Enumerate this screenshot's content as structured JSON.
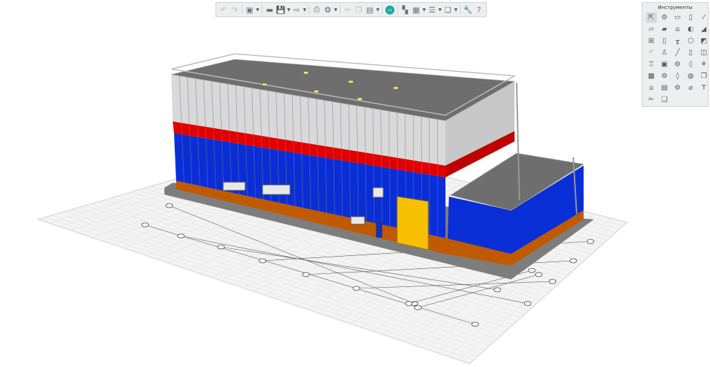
{
  "toolbar": {
    "buttons": [
      {
        "icon": "undo-icon",
        "glyph": "↶",
        "disabled": true
      },
      {
        "icon": "redo-icon",
        "glyph": "↷",
        "disabled": true
      },
      {
        "icon": "new-project-icon",
        "glyph": "▣",
        "dropdown": true
      },
      {
        "icon": "open-folder-icon",
        "glyph": "▬"
      },
      {
        "icon": "save-icon",
        "glyph": "💾",
        "dropdown": true
      },
      {
        "icon": "export-icon",
        "glyph": "⇨",
        "dropdown": true
      },
      {
        "icon": "print-icon",
        "glyph": "⎙"
      },
      {
        "icon": "view-3d-icon",
        "glyph": "❂",
        "dropdown": true
      },
      {
        "icon": "cut-icon",
        "glyph": "✂",
        "disabled": true
      },
      {
        "icon": "copy-icon",
        "glyph": "❐",
        "disabled": true
      },
      {
        "icon": "paste-icon",
        "glyph": "▤",
        "dropdown": true
      },
      {
        "icon": "code-icon",
        "glyph": "‹›",
        "teal": true
      },
      {
        "icon": "structure-icon",
        "glyph": "▚"
      },
      {
        "icon": "calculator-icon",
        "glyph": "▦",
        "dropdown": true
      },
      {
        "icon": "layers-icon",
        "glyph": "☰",
        "dropdown": true
      },
      {
        "icon": "views-icon",
        "glyph": "❏",
        "dropdown": true
      },
      {
        "icon": "wrench-icon",
        "glyph": "🔧"
      },
      {
        "icon": "help-icon",
        "glyph": "?"
      }
    ]
  },
  "tools_panel": {
    "title": "Инструменты",
    "tools": [
      {
        "icon": "pointer-icon",
        "glyph": "⇱",
        "selected": true
      },
      {
        "icon": "object-icon",
        "glyph": "⚙"
      },
      {
        "icon": "rectangle-icon",
        "glyph": "▭"
      },
      {
        "icon": "column-icon",
        "glyph": "▯"
      },
      {
        "icon": "beam-icon",
        "glyph": "⁄"
      },
      {
        "icon": "slab-icon",
        "glyph": "▱"
      },
      {
        "icon": "slab-opening-icon",
        "glyph": "▰"
      },
      {
        "icon": "roof-icon",
        "glyph": "⌂"
      },
      {
        "icon": "roll-icon",
        "glyph": "◐"
      },
      {
        "icon": "ramp-icon",
        "glyph": "◢"
      },
      {
        "icon": "window-icon",
        "glyph": "⊞"
      },
      {
        "icon": "door-icon",
        "glyph": "▯"
      },
      {
        "icon": "table-icon",
        "glyph": "╥"
      },
      {
        "icon": "component-icon",
        "glyph": "⬡"
      },
      {
        "icon": "wall-opening-icon",
        "glyph": "◩"
      },
      {
        "icon": "stair-icon",
        "glyph": "◜"
      },
      {
        "icon": "railing-icon",
        "glyph": "♙"
      },
      {
        "icon": "line-icon",
        "glyph": "╱"
      },
      {
        "icon": "pipe-icon",
        "glyph": "▯"
      },
      {
        "icon": "zone-icon",
        "glyph": "◫"
      },
      {
        "icon": "equipment-icon",
        "glyph": "♖"
      },
      {
        "icon": "panel-icon",
        "glyph": "▣"
      },
      {
        "icon": "fixture-icon",
        "glyph": "⚙"
      },
      {
        "icon": "duct-icon",
        "glyph": "◊"
      },
      {
        "icon": "fitting-icon",
        "glyph": "⚘"
      },
      {
        "icon": "foundation-icon",
        "glyph": "▩"
      },
      {
        "icon": "rebar-icon",
        "glyph": "⚙"
      },
      {
        "icon": "profile-icon",
        "glyph": "◊"
      },
      {
        "icon": "shell-icon",
        "glyph": "◍"
      },
      {
        "icon": "copy-element-icon",
        "glyph": "❐"
      },
      {
        "icon": "house-icon",
        "glyph": "⌂"
      },
      {
        "icon": "cabinet-icon",
        "glyph": "▤"
      },
      {
        "icon": "gear-settings-icon",
        "glyph": "⚙"
      },
      {
        "icon": "dimension-icon",
        "glyph": "⌀"
      },
      {
        "icon": "text-icon",
        "glyph": "T"
      },
      {
        "icon": "cut-line-icon",
        "glyph": "✁"
      },
      {
        "icon": "section-icon",
        "glyph": "❏"
      }
    ]
  },
  "colors": {
    "roof": "#6e6e6e",
    "panel": "#d9d9d9",
    "band": "#e00000",
    "wall": "#0a2ed6",
    "base": "#c05a00",
    "door": "#f6c000",
    "slab": "#8a8a8a"
  }
}
